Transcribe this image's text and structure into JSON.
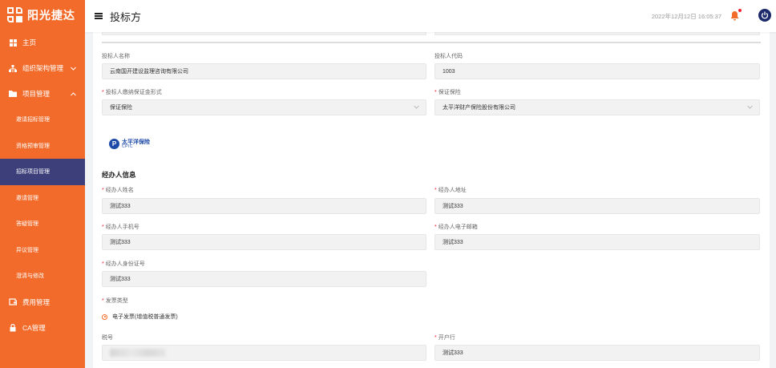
{
  "app": {
    "logo_text": "阳光捷达"
  },
  "sidebar": {
    "items": [
      {
        "label": "主页",
        "icon": "windows-icon"
      },
      {
        "label": "组织架构管理",
        "icon": "org-chart-icon",
        "chevron": "chevron-down"
      },
      {
        "label": "项目管理",
        "icon": "folder-icon",
        "chevron": "chevron-up"
      }
    ],
    "sub_items": [
      {
        "label": "邀请招标管理",
        "active": false
      },
      {
        "label": "资格预审管理",
        "active": false
      },
      {
        "label": "招标项目管理",
        "active": true
      },
      {
        "label": "邀请管理",
        "active": false
      },
      {
        "label": "答疑管理",
        "active": false
      },
      {
        "label": "异议管理",
        "active": false
      },
      {
        "label": "澄清与修改",
        "active": false
      }
    ],
    "bottom_items": [
      {
        "label": "费用管理",
        "icon": "wallet-icon"
      },
      {
        "label": "CA管理",
        "icon": "lock-icon"
      }
    ]
  },
  "header": {
    "title": "投标方",
    "datetime": "2022年12月12日 16:05:37"
  },
  "form": {
    "bidder_name_label": "投标人名称",
    "bidder_name_value": "云南国开建设监理咨询有限公司",
    "bidder_code_label": "投标人代码",
    "bidder_code_value": "1003",
    "deposit_form_label": "投标人缴纳保证金形式",
    "deposit_form_value": "保证保险",
    "guarantee_insurance_label": "保证保险",
    "guarantee_insurance_value": "太平洋财产保险股份有限公司",
    "insurer_logo_cn": "太平洋保险",
    "insurer_logo_en": "CPIC",
    "agent_section_title": "经办人信息",
    "agent_name_label": "经办人姓名",
    "agent_name_value": "测试333",
    "agent_address_label": "经办人地址",
    "agent_address_value": "测试333",
    "agent_phone_label": "经办人手机号",
    "agent_phone_value": "测试333",
    "agent_email_label": "经办人电子邮箱",
    "agent_email_value": "测试333",
    "agent_id_label": "经办人身份证号",
    "agent_id_value": "测试333",
    "invoice_type_label": "发票类型",
    "invoice_type_option": "电子发票(增值税普通发票)",
    "tax_no_label": "税号",
    "bank_label": "开户行",
    "bank_value": "测试333"
  },
  "colors": {
    "sidebar": "#f26b2a",
    "active_item": "#3d3f7a",
    "required": "#f5222d"
  }
}
